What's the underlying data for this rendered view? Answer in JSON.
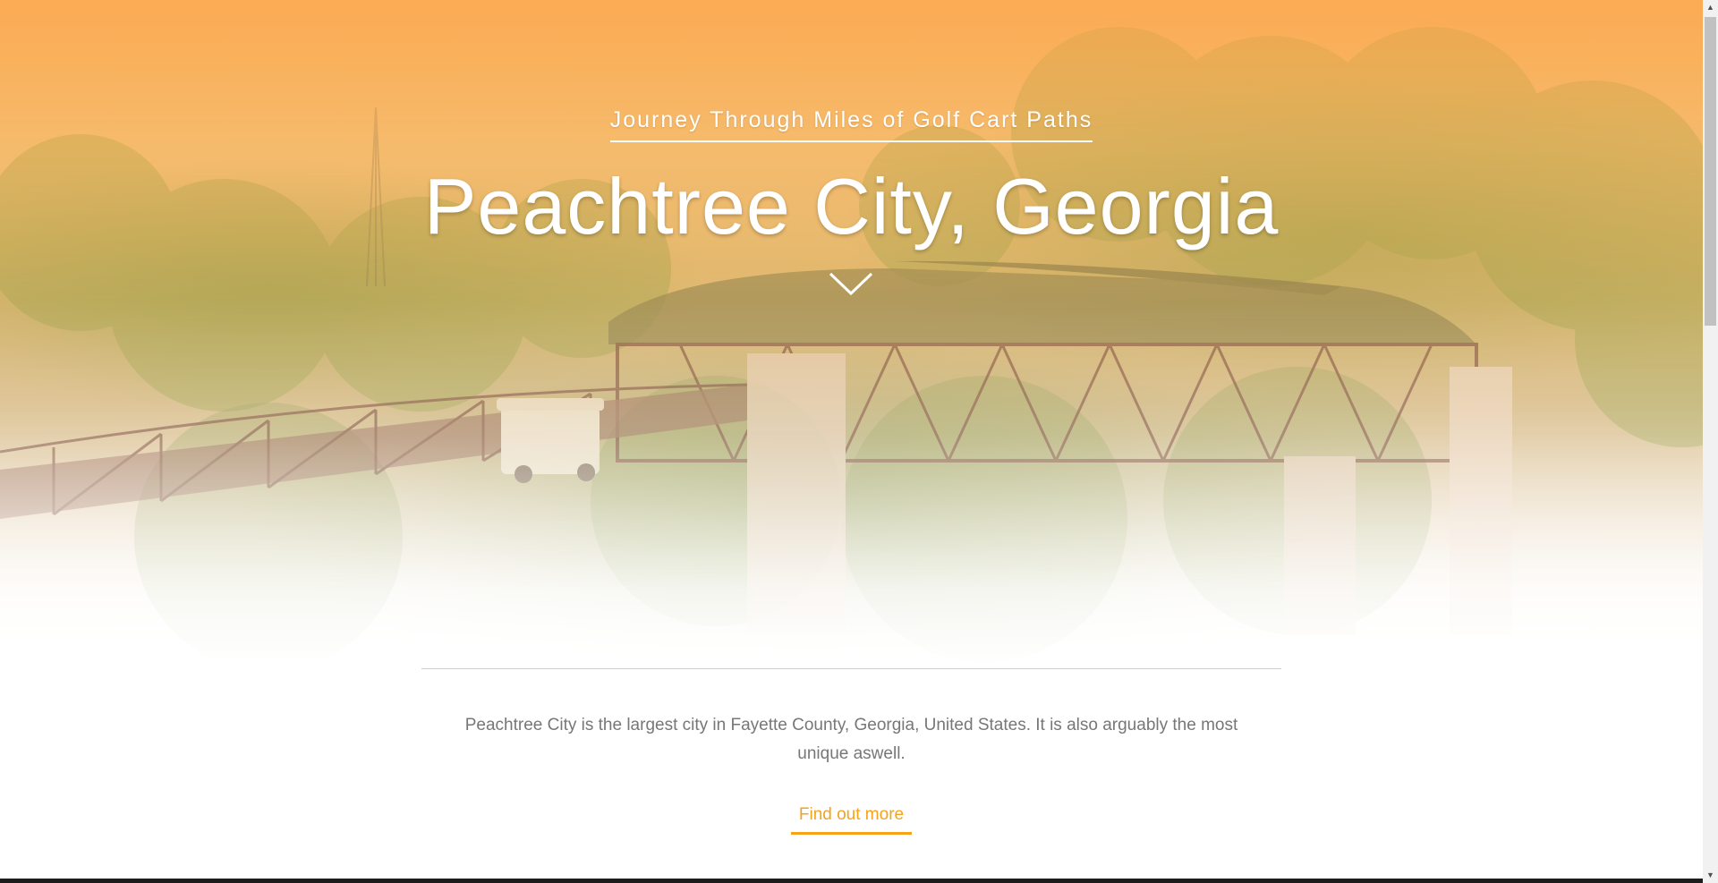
{
  "hero": {
    "eyebrow": "Journey Through Miles of Golf Cart Paths",
    "title": "Peachtree City, Georgia",
    "scroll_icon": "chevron-down-icon"
  },
  "intro": {
    "text": "Peachtree City is the largest city in Fayette County, Georgia, United States. It is also arguably the most unique aswell.",
    "cta_label": "Find out more"
  },
  "scrollbar": {
    "up_icon": "triangle-up-icon",
    "down_icon": "triangle-down-icon"
  },
  "colors": {
    "accent": "#f6a21b",
    "hero_top": "#fca84e",
    "text_muted": "#777777"
  }
}
